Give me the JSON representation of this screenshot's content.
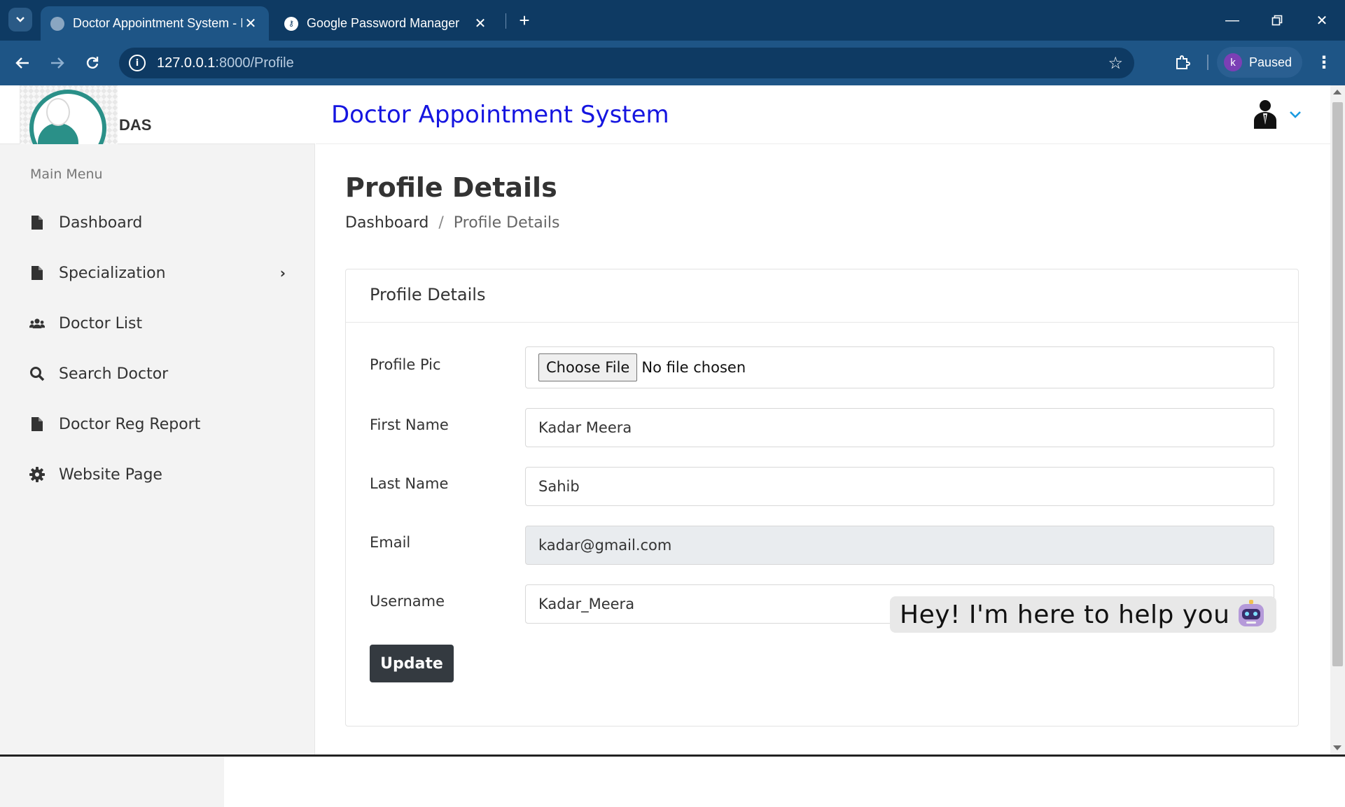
{
  "browser": {
    "tabs": [
      {
        "title": "Doctor Appointment System - I",
        "active": true
      },
      {
        "title": "Google Password Manager",
        "active": false
      }
    ],
    "url_host": "127.0.0.1",
    "url_path": ":8000/Profile",
    "profile_initial": "k",
    "profile_status": "Paused"
  },
  "sidebar": {
    "logo_text": "DAS",
    "menu_title": "Main Menu",
    "items": [
      {
        "label": "Dashboard",
        "icon": "file-icon"
      },
      {
        "label": "Specialization",
        "icon": "file-icon",
        "has_submenu": true
      },
      {
        "label": "Doctor List",
        "icon": "users-icon"
      },
      {
        "label": "Search Doctor",
        "icon": "search-icon"
      },
      {
        "label": "Doctor Reg Report",
        "icon": "file-icon"
      },
      {
        "label": "Website Page",
        "icon": "gear-icon"
      }
    ]
  },
  "header": {
    "title": "Doctor Appointment System"
  },
  "main": {
    "page_title": "Profile Details",
    "breadcrumb": {
      "home": "Dashboard",
      "separator": "/",
      "current": "Profile Details"
    },
    "card": {
      "title": "Profile Details",
      "fields": {
        "profile_pic": {
          "label": "Profile Pic",
          "button": "Choose File",
          "status": "No file chosen"
        },
        "first_name": {
          "label": "First Name",
          "value": "Kadar Meera"
        },
        "last_name": {
          "label": "Last Name",
          "value": "Sahib"
        },
        "email": {
          "label": "Email",
          "value": "kadar@gmail.com"
        },
        "username": {
          "label": "Username",
          "value": "Kadar_Meera"
        }
      },
      "submit_label": "Update"
    }
  },
  "chatbot": {
    "greeting": "Hey! I'm here to help you"
  },
  "colors": {
    "title_blue": "#1515e0",
    "chrome_dark": "#0e3a63",
    "chrome_toolbar": "#1e5586",
    "button_dark": "#343a40"
  }
}
